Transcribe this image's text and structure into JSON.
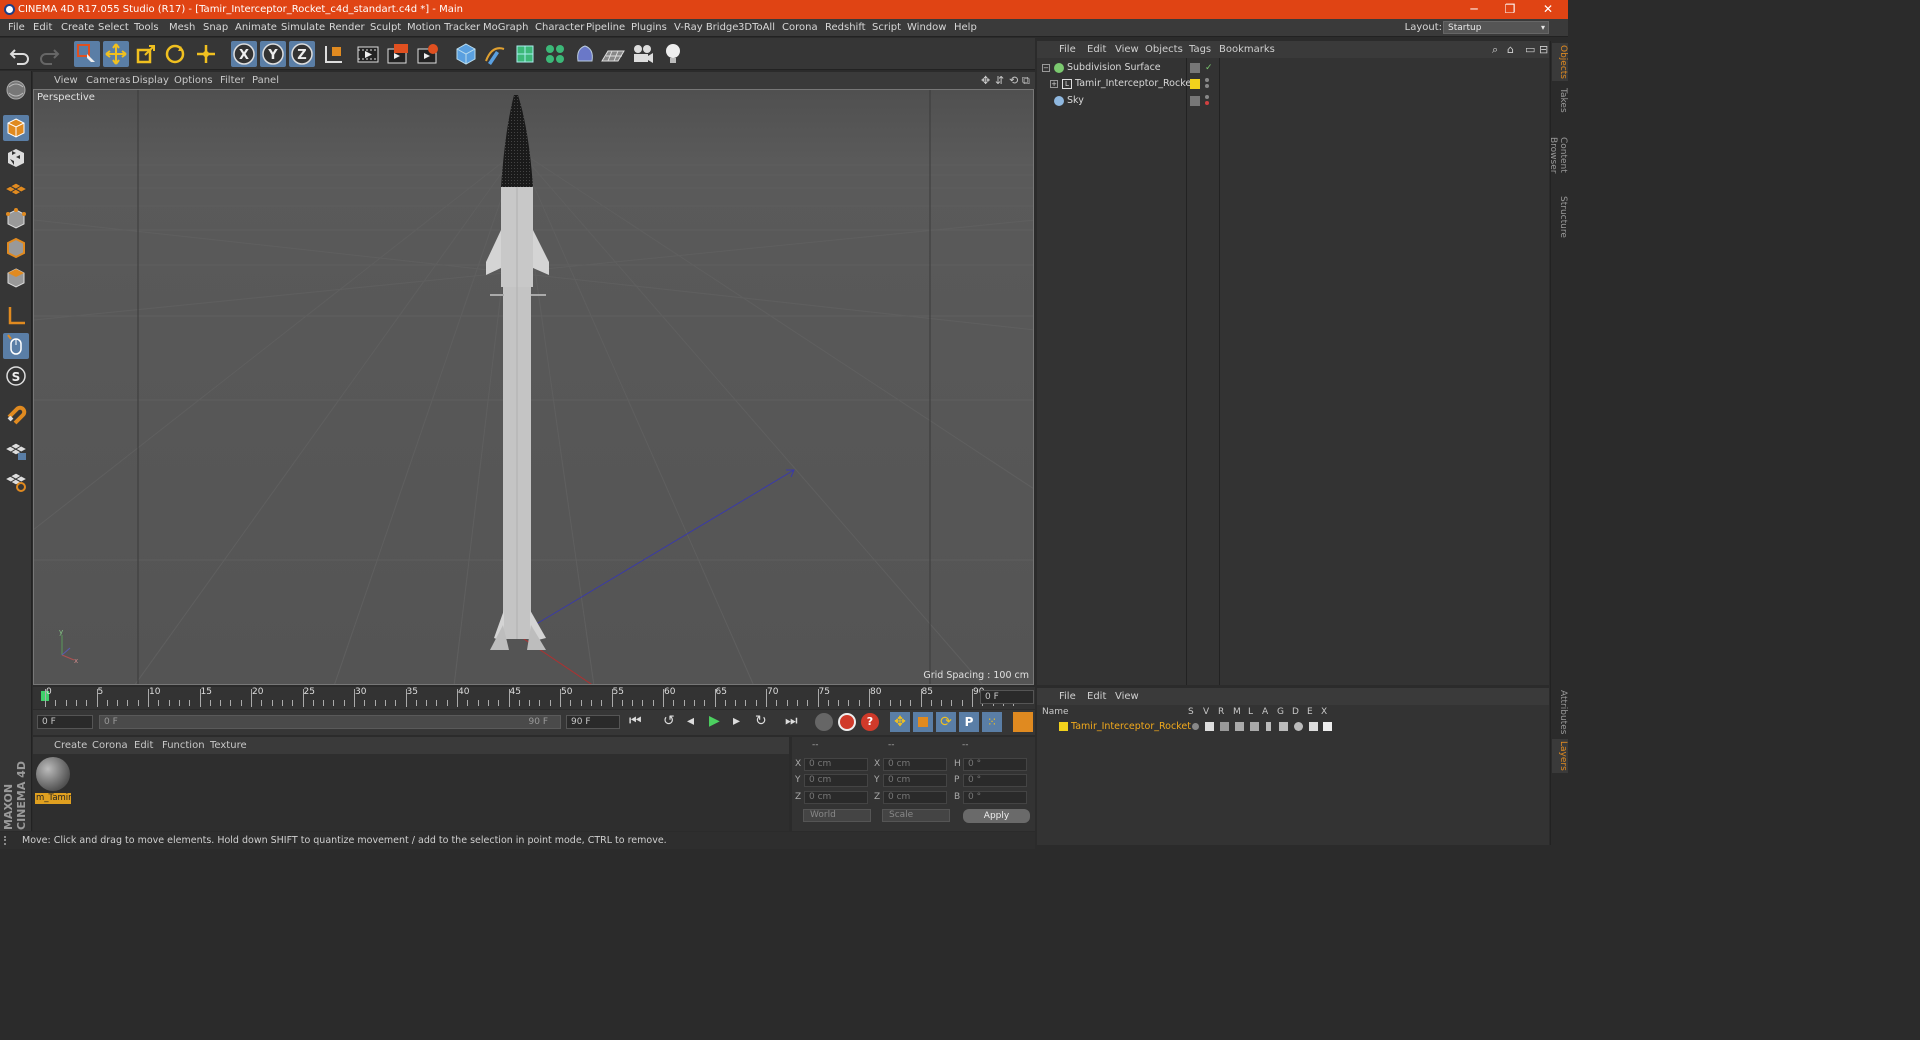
{
  "window": {
    "title": "CINEMA 4D R17.055 Studio (R17) - [Tamir_Interceptor_Rocket_c4d_standart.c4d *] - Main",
    "minimize": "─",
    "maximize": "❐",
    "close": "✕"
  },
  "menubar": {
    "items": [
      "File",
      "Edit",
      "Create",
      "Select",
      "Tools",
      "Mesh",
      "Snap",
      "Animate",
      "Simulate",
      "Render",
      "Sculpt",
      "Motion Tracker",
      "MoGraph",
      "Character",
      "Pipeline",
      "Plugins",
      "V-Ray Bridge",
      "3DToAll",
      "Corona",
      "Redshift",
      "Script",
      "Window",
      "Help"
    ],
    "layout_label": "Layout:",
    "layout_value": "Startup"
  },
  "toolbar": {
    "icons": [
      "undo-icon",
      "redo-icon",
      "live-selection-icon",
      "move-icon",
      "scale-icon",
      "rotate-icon",
      "transform-icon",
      "x-axis-icon",
      "y-axis-icon",
      "z-axis-icon",
      "world-coordinates-icon",
      "render-view-icon",
      "render-picture-viewer-icon",
      "edit-render-settings-icon",
      "cube-icon",
      "pen-icon",
      "subdivision-icon",
      "cloner-icon",
      "deformer-icon",
      "floor-icon",
      "camera-icon",
      "light-icon"
    ]
  },
  "viewport": {
    "menu": [
      "View",
      "Cameras",
      "Display",
      "Options",
      "Filter",
      "Panel"
    ],
    "label": "Perspective",
    "grid_spacing": "Grid Spacing : 100 cm"
  },
  "timeline": {
    "ticks": [
      "0",
      "5",
      "10",
      "15",
      "20",
      "25",
      "30",
      "35",
      "40",
      "45",
      "50",
      "55",
      "60",
      "65",
      "70",
      "75",
      "80",
      "85",
      "90"
    ],
    "current_frame": "0 F",
    "start_field": "0 F",
    "range_start": "0 F",
    "range_end": "90 F",
    "end_field": "90 F"
  },
  "material_manager": {
    "menu": [
      "Create",
      "Corona",
      "Edit",
      "Function",
      "Texture"
    ],
    "materials": [
      {
        "name": "m_Tamir"
      }
    ]
  },
  "coordinates": {
    "header": [
      "--",
      "--",
      "--"
    ],
    "rows": [
      {
        "l1": "X",
        "v1": "0 cm",
        "l2": "X",
        "v2": "0 cm",
        "l3": "H",
        "v3": "0 °"
      },
      {
        "l1": "Y",
        "v1": "0 cm",
        "l2": "Y",
        "v2": "0 cm",
        "l3": "P",
        "v3": "0 °"
      },
      {
        "l1": "Z",
        "v1": "0 cm",
        "l2": "Z",
        "v2": "0 cm",
        "l3": "B",
        "v3": "0 °"
      }
    ],
    "mode": "World",
    "size_mode": "Scale",
    "apply": "Apply"
  },
  "object_manager": {
    "menu": [
      "File",
      "Edit",
      "View",
      "Objects",
      "Tags",
      "Bookmarks"
    ],
    "objects": [
      {
        "name": "Subdivision Surface",
        "color": "#7bc96f"
      },
      {
        "name": "Tamir_Interceptor_Rocket",
        "color": "#f2d21c"
      },
      {
        "name": "Sky",
        "color": "#8fb8e0"
      }
    ]
  },
  "layer_manager": {
    "menu": [
      "File",
      "Edit",
      "View"
    ],
    "columns": [
      "Name",
      "S",
      "V",
      "R",
      "M",
      "L",
      "A",
      "G",
      "D",
      "E",
      "X"
    ],
    "layers": [
      {
        "name": "Tamir_Interceptor_Rocket",
        "color": "#f2d21c"
      }
    ]
  },
  "side_tabs": [
    "Objects",
    "Takes",
    "Content Browser",
    "Structure"
  ],
  "side_tabs_bottom": [
    "Attributes",
    "Layers"
  ],
  "status": "Move: Click and drag to move elements. Hold down SHIFT to quantize movement / add to the selection in point mode, CTRL to remove.",
  "branding": "MAXON CINEMA 4D",
  "colors": {
    "title_bar": "#e04414",
    "highlight": "#5a7ea6",
    "layer_name": "#f2a91c"
  }
}
